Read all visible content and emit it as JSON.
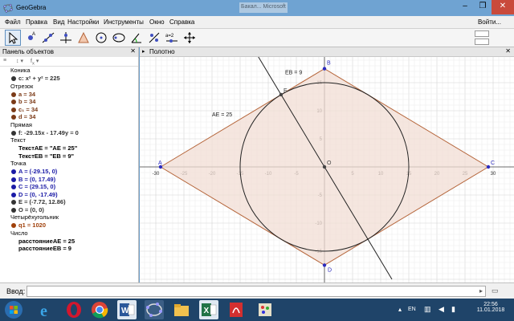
{
  "window": {
    "title": "GeoGebra",
    "tab": "Бакал... Microsoft Ex..."
  },
  "menu": [
    "Файл",
    "Правка",
    "Вид",
    "Настройки",
    "Инструменты",
    "Окно",
    "Справка"
  ],
  "login": "Войти...",
  "algebra": {
    "title": "Панель объектов",
    "categories": [
      {
        "name": "Коника",
        "items": [
          {
            "text": "c: x² + y² = 225",
            "color": "#333333"
          }
        ]
      },
      {
        "name": "Отрезок",
        "items": [
          {
            "text": "a = 34",
            "color": "#7b3a17"
          },
          {
            "text": "b = 34",
            "color": "#7b3a17"
          },
          {
            "text": "c₁ = 34",
            "color": "#7b3a17"
          },
          {
            "text": "d = 34",
            "color": "#7b3a17"
          }
        ]
      },
      {
        "name": "Прямая",
        "items": [
          {
            "text": "f: -29.15x - 17.49y = 0",
            "color": "#333333"
          }
        ]
      },
      {
        "name": "Текст",
        "items": [
          {
            "text": "ТекстAE = \"AE = 25\"",
            "color": "#000000"
          },
          {
            "text": "ТекстEB = \"EB = 9\"",
            "color": "#000000"
          }
        ]
      },
      {
        "name": "Точка",
        "items": [
          {
            "text": "A = (-29.15, 0)",
            "color": "#1a1aa6"
          },
          {
            "text": "B = (0, 17.49)",
            "color": "#1a1aa6"
          },
          {
            "text": "C = (29.15, 0)",
            "color": "#1a1aa6"
          },
          {
            "text": "D = (0, -17.49)",
            "color": "#1a1aa6"
          },
          {
            "text": "E = (-7.72, 12.86)",
            "color": "#333333"
          },
          {
            "text": "O = (0, 0)",
            "color": "#333333"
          }
        ]
      },
      {
        "name": "Четырёхугольник",
        "items": [
          {
            "text": "q1 = 1020",
            "color": "#a0400a"
          }
        ]
      },
      {
        "name": "Число",
        "items": [
          {
            "text": "расстояниеAE = 25",
            "color": "#000000"
          },
          {
            "text": "расстояниеEB = 9",
            "color": "#000000"
          }
        ]
      }
    ]
  },
  "view": {
    "title": "Полотно"
  },
  "graph": {
    "xticks": [
      -30,
      -25,
      -20,
      -15,
      -10,
      -5,
      0,
      5,
      10,
      15,
      20,
      25,
      30
    ],
    "yticks": [
      -15,
      -10,
      -5,
      5,
      10,
      15
    ],
    "points": [
      {
        "label": "A",
        "x": -29.15,
        "y": 0
      },
      {
        "label": "B",
        "x": 0,
        "y": 17.49
      },
      {
        "label": "C",
        "x": 29.15,
        "y": 0
      },
      {
        "label": "D",
        "x": 0,
        "y": -17.49
      },
      {
        "label": "E",
        "x": -7.72,
        "y": 12.86
      },
      {
        "label": "O",
        "x": 0,
        "y": 0
      }
    ],
    "circle_radius": 15,
    "line_f": "-29.15x - 17.49y = 0",
    "text_AE": "AE = 25",
    "text_EB": "EB = 9"
  },
  "input": {
    "label": "Ввод:",
    "value": ""
  },
  "taskbar": {
    "lang": "EN",
    "time": "22:56",
    "date": "11.01.2018"
  },
  "colors": {
    "fill": "#f2ddd4",
    "edge": "#b5653a",
    "point": "#2b2bbf"
  }
}
